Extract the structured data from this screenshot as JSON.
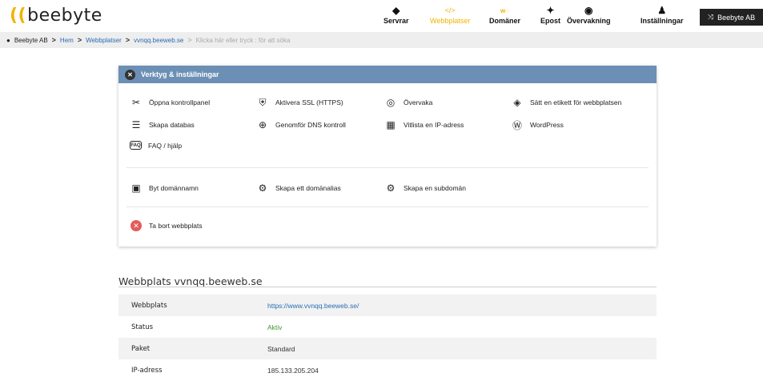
{
  "logo": {
    "mark": "((",
    "text": "beebyte"
  },
  "nav": [
    {
      "label": "Servrar",
      "icon": "layers-icon",
      "glyph": "◆"
    },
    {
      "label": "Webbplatser",
      "icon": "code-icon",
      "glyph": "</>"
    },
    {
      "label": "Domäner",
      "icon": "domain-search-icon",
      "glyph": "www🔍"
    },
    {
      "label": "Epost",
      "icon": "people-icon",
      "glyph": "✦"
    },
    {
      "label": "Övervakning",
      "icon": "eye-icon",
      "glyph": "◉"
    },
    {
      "label": "Inställningar",
      "icon": "user-gear-icon",
      "glyph": "♟"
    }
  ],
  "account": {
    "label": "Beebyte AB",
    "icon": "shuffle-icon"
  },
  "breadcrumb": {
    "root": "Beebyte AB",
    "items": [
      "Hem",
      "Webbplatser",
      "vvnqq.beeweb.se"
    ],
    "hint": "Klicka här eller tryck : för att söka"
  },
  "tools_panel": {
    "title": "Verktyg & inställningar",
    "group1": [
      {
        "label": "Öppna kontrollpanel",
        "icon": "tools-icon",
        "glyph": "✂"
      },
      {
        "label": "Aktivera SSL (HTTPS)",
        "icon": "ssl-shield-icon",
        "glyph": "⛨"
      },
      {
        "label": "Övervaka",
        "icon": "eye-box-icon",
        "glyph": "◎"
      },
      {
        "label": "Sätt en etikett för webbplatsen",
        "icon": "tag-icon",
        "glyph": "⌂"
      },
      {
        "label": "Skapa databas",
        "icon": "database-icon",
        "glyph": "☰"
      },
      {
        "label": "Genomför DNS kontroll",
        "icon": "globe-icon",
        "glyph": "⊕"
      },
      {
        "label": "Vitlista en IP-adress",
        "icon": "firewall-icon",
        "glyph": "▦"
      },
      {
        "label": "WordPress",
        "icon": "wordpress-icon",
        "glyph": "Ⓦ"
      },
      {
        "label": "FAQ / hjälp",
        "icon": "faq-icon",
        "glyph": "FAQ"
      }
    ],
    "group2": [
      {
        "label": "Byt domännamn",
        "icon": "id-card-icon",
        "glyph": "▣"
      },
      {
        "label": "Skapa ett domänalias",
        "icon": "gears-icon",
        "glyph": "⚙"
      },
      {
        "label": "Skapa en subdomän",
        "icon": "gears-icon",
        "glyph": "⚙"
      }
    ],
    "delete": {
      "label": "Ta bort webbplats",
      "icon": "delete-icon",
      "glyph": "✕"
    }
  },
  "details": {
    "title": "Webbplats vvnqq.beeweb.se",
    "rows": [
      {
        "key": "Webbplats",
        "value": "https://www.vvnqq.beeweb.se/"
      },
      {
        "key": "Status",
        "value": "Aktiv"
      },
      {
        "key": "Paket",
        "value": "Standard"
      },
      {
        "key": "IP-adress",
        "value": "185.133.205.204"
      }
    ]
  },
  "colors": {
    "accent": "#f0b400",
    "panel_header": "#6c8fb5",
    "link": "#2a6db5",
    "status_ok": "#3a9a2a",
    "danger": "#e35b5b"
  }
}
